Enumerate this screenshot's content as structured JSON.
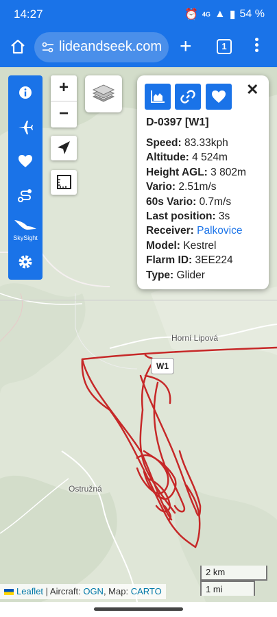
{
  "status_bar": {
    "time": "14:27",
    "network": "4G",
    "battery": "54 %"
  },
  "browser": {
    "url": "lideandseek.com",
    "tab_count": "1"
  },
  "sidebar": {
    "skysight_label": "SkySight"
  },
  "zoom": {
    "in_label": "+",
    "out_label": "−"
  },
  "popup": {
    "title": "D-0397 [W1]",
    "close_label": "✕",
    "rows": [
      {
        "label": "Speed:",
        "value": "83.33kph"
      },
      {
        "label": "Altitude:",
        "value": "4 524m"
      },
      {
        "label": "Height AGL:",
        "value": "3 802m"
      },
      {
        "label": "Vario:",
        "value": "2.51m/s"
      },
      {
        "label": "60s Vario:",
        "value": "0.7m/s"
      },
      {
        "label": "Last position:",
        "value": "3s"
      },
      {
        "label": "Receiver:",
        "value": "Palkovice"
      },
      {
        "label": "Model:",
        "value": "Kestrel"
      },
      {
        "label": "Flarm ID:",
        "value": "3EE224"
      },
      {
        "label": "Type:",
        "value": "Glider"
      }
    ]
  },
  "map": {
    "labels": {
      "town1": "Horní Lipová",
      "town2": "Ostružná"
    },
    "marker_label": "W1",
    "track_color": "#c62828",
    "scale": {
      "metric": "2 km",
      "imperial": "1 mi"
    },
    "attribution": {
      "leaflet": "Leaflet",
      "sep1": " | Aircraft: ",
      "aircraft": "OGN",
      "sep2": ", Map: ",
      "map": "CARTO"
    }
  },
  "icons": {
    "home": "home-icon",
    "info": "info-icon",
    "plane": "airplane-icon",
    "heart": "heart-icon",
    "route": "route-icon",
    "bird": "bird-icon",
    "gear": "gear-icon",
    "layers": "layers-icon",
    "locate": "navigation-arrow-icon",
    "ruler": "ruler-icon",
    "chart": "chart-icon",
    "link": "link-icon"
  },
  "accent_color": "#1a73e8"
}
